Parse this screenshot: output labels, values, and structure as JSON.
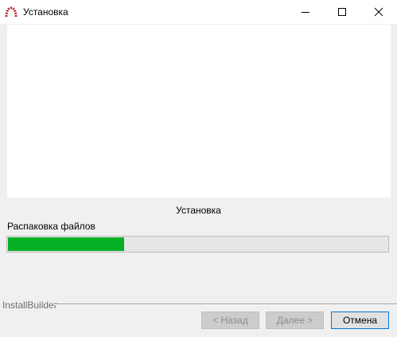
{
  "window": {
    "title": "Установка",
    "icons": [
      "app-logo-icon",
      "minimize-icon",
      "maximize-icon",
      "close-icon"
    ]
  },
  "main": {
    "section_title": "Установка",
    "progress_label": "Распаковка файлов",
    "progress_value": 0.306,
    "progress_color": "#06b025"
  },
  "footer": {
    "brand": "InstallBuilder",
    "back_label": "< Назад",
    "next_label": "Далее >",
    "cancel_label": "Отмена",
    "accent_color": "#0078d7"
  }
}
